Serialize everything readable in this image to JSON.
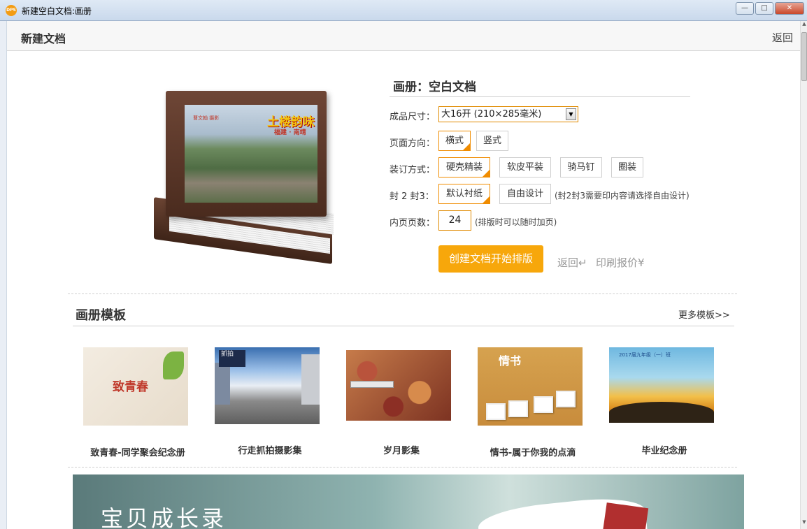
{
  "window": {
    "title": "新建空白文档:画册",
    "app_badge": "DPS",
    "min_label": "—",
    "max_label": "□",
    "close_label": "✕"
  },
  "header": {
    "title": "新建文档",
    "back_label": "返回"
  },
  "book_cover": {
    "title": "土楼韵味",
    "subtitle": "福建 · 南靖",
    "author": "曹文翰 摄影"
  },
  "form": {
    "title": "画册：空白文档",
    "size_label": "成品尺寸：",
    "size_value": "大16开 (210×285毫米)",
    "orientation_label": "页面方向：",
    "orientation_options": [
      "横式",
      "竖式"
    ],
    "orientation_selected": "横式",
    "binding_label": "装订方式：",
    "binding_options": [
      "硬壳精装",
      "软皮平装",
      "骑马钉",
      "圈装"
    ],
    "binding_selected": "硬壳精装",
    "cover23_label": "封 2 封3：",
    "cover23_options": [
      "默认衬纸",
      "自由设计"
    ],
    "cover23_selected": "默认衬纸",
    "cover23_note": "(封2封3需要印内容请选择自由设计)",
    "pages_label": "内页页数：",
    "pages_value": "24",
    "pages_note": "(排版时可以随时加页)",
    "create_label": "创建文档开始排版",
    "back_link": "返回↵",
    "quote_link": "印刷报价¥"
  },
  "templates": {
    "heading": "画册模板",
    "more_label": "更多模板>>",
    "items": [
      {
        "name": "致青春-同学聚会纪念册",
        "thumb_text": "致青春"
      },
      {
        "name": "行走抓拍摄影集",
        "thumb_text": "抓拍"
      },
      {
        "name": "岁月影集",
        "thumb_text": ""
      },
      {
        "name": "情书-属于你我的点滴",
        "thumb_text": "情书"
      },
      {
        "name": "毕业纪念册",
        "thumb_text": "2017届九年级（一）班"
      }
    ]
  },
  "banner": {
    "text": "宝贝成长录"
  },
  "colors": {
    "accent": "#f7a70b",
    "selected_border": "#f08c00"
  }
}
